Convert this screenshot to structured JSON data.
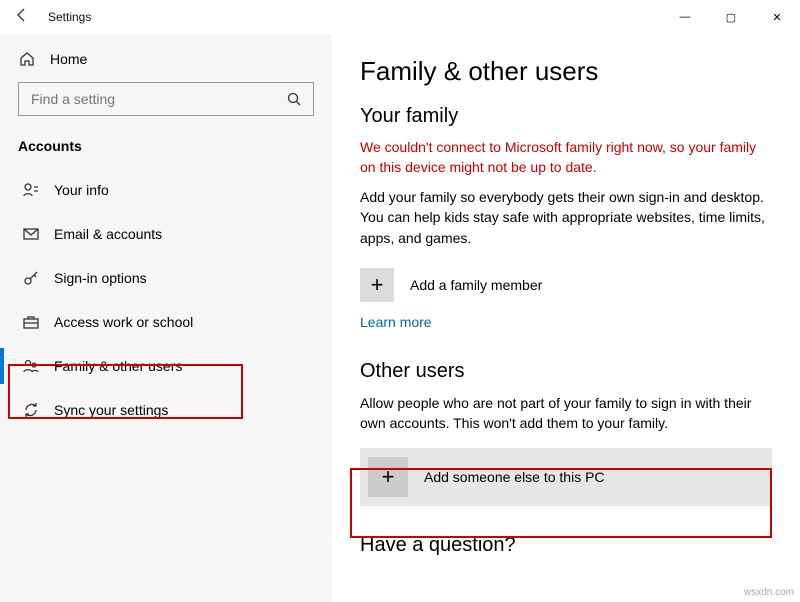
{
  "window": {
    "title": "Settings",
    "controls": {
      "min": "—",
      "max": "▢",
      "close": "✕"
    }
  },
  "sidebar": {
    "home": "Home",
    "search_placeholder": "Find a setting",
    "section": "Accounts",
    "items": [
      {
        "icon": "person-card-icon",
        "label": "Your info"
      },
      {
        "icon": "mail-icon",
        "label": "Email & accounts"
      },
      {
        "icon": "key-icon",
        "label": "Sign-in options"
      },
      {
        "icon": "briefcase-icon",
        "label": "Access work or school"
      },
      {
        "icon": "family-icon",
        "label": "Family & other users"
      },
      {
        "icon": "sync-icon",
        "label": "Sync your settings"
      }
    ]
  },
  "page": {
    "title": "Family & other users",
    "family": {
      "heading": "Your family",
      "error": "We couldn't connect to Microsoft family right now, so your family on this device might not be up to date.",
      "desc": "Add your family so everybody gets their own sign-in and desktop. You can help kids stay safe with appropriate websites, time limits, apps, and games.",
      "add_label": "Add a family member",
      "learn_more": "Learn more"
    },
    "others": {
      "heading": "Other users",
      "desc": "Allow people who are not part of your family to sign in with their own accounts. This won't add them to your family.",
      "add_label": "Add someone else to this PC"
    },
    "question_heading": "Have a question?"
  },
  "watermark": "wsxdn.com"
}
